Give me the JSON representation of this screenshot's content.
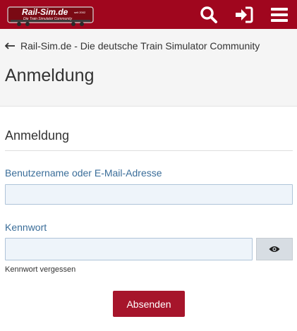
{
  "brand": {
    "logo_text": "Rail-Sim.de",
    "logo_tagline": "Die Train Simulator Community",
    "logo_badge": "seit 2002",
    "accent": "#a0061e",
    "button_color": "#a6152b"
  },
  "topbar": {
    "icons": [
      "search-icon",
      "sign-in-icon",
      "menu-icon"
    ]
  },
  "breadcrumb": {
    "label": "Rail-Sim.de - Die deutsche Train Simulator Community"
  },
  "page": {
    "title": "Anmeldung"
  },
  "form": {
    "section_title": "Anmeldung",
    "username_label": "Benutzername oder E-Mail-Adresse",
    "username_value": "",
    "password_label": "Kennwort",
    "password_value": "",
    "forgot_label": "Kennwort vergessen",
    "submit_label": "Absenden"
  }
}
